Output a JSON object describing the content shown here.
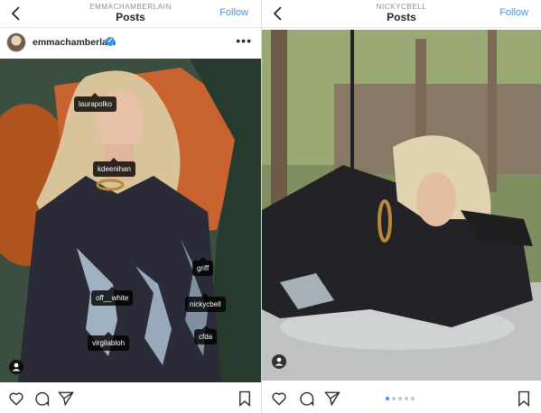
{
  "left_post": {
    "header": {
      "username": "EMMACHAMBERLAIN",
      "title": "Posts",
      "follow_label": "Follow"
    },
    "post": {
      "username": "emmachamberlain",
      "verified": true
    },
    "tags": [
      {
        "name": "laurapolko"
      },
      {
        "name": "kdeenihan"
      },
      {
        "name": "griff"
      },
      {
        "name": "off__white"
      },
      {
        "name": "nickycbell"
      },
      {
        "name": "cfda"
      },
      {
        "name": "virgilabloh"
      }
    ]
  },
  "right_post": {
    "header": {
      "username": "NICKYCBELL",
      "title": "Posts",
      "follow_label": "Follow"
    },
    "carousel": {
      "current": 1,
      "total": 5
    }
  },
  "colors": {
    "accent": "#3897f0",
    "text": "#262626",
    "muted": "#8e8e8e"
  },
  "icons": [
    "back-icon",
    "more-icon",
    "heart-icon",
    "comment-icon",
    "share-icon",
    "bookmark-icon",
    "user-tag-icon"
  ]
}
